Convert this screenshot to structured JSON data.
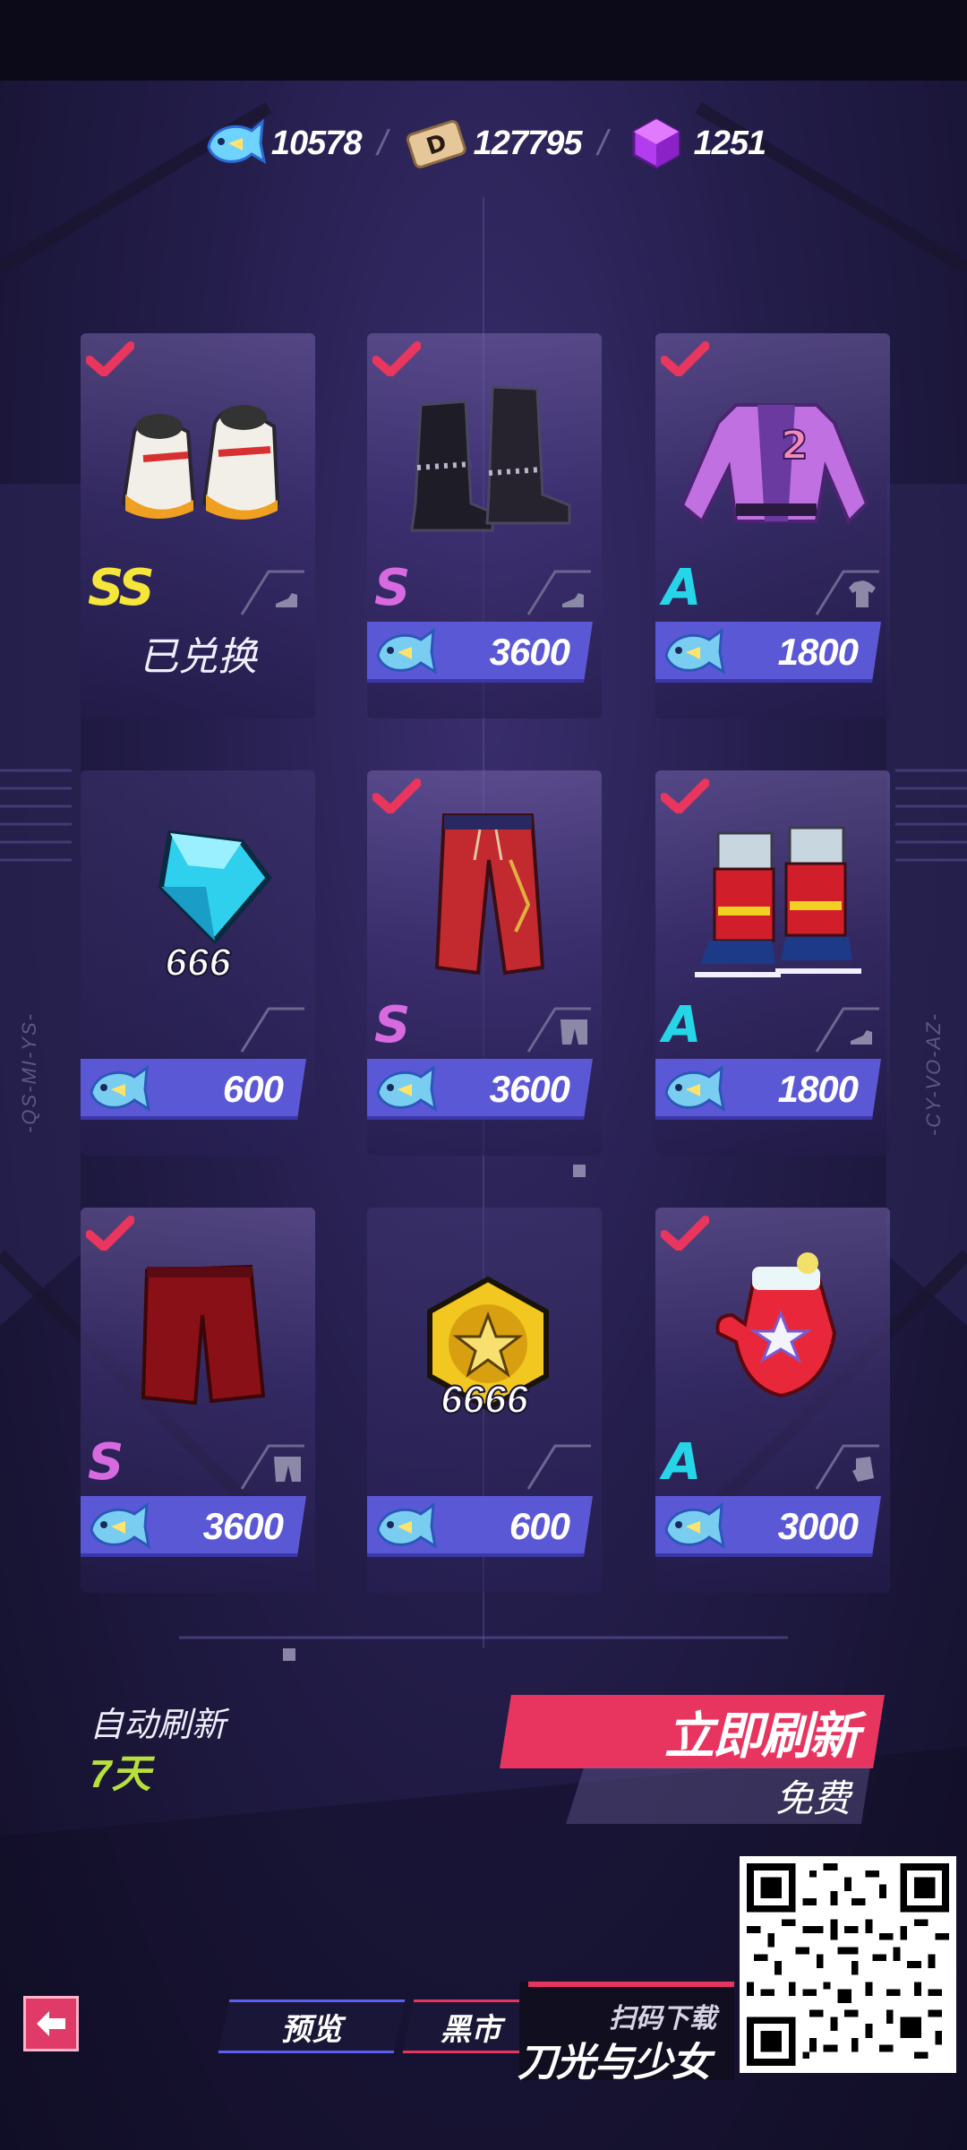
{
  "currencies": [
    {
      "icon": "fish-coin-icon",
      "value": "10578"
    },
    {
      "icon": "d-ticket-icon",
      "value": "127795"
    },
    {
      "icon": "purple-cube-icon",
      "value": "1251"
    }
  ],
  "currency_separator": "/",
  "shop_items": [
    {
      "name": "white-sneakers",
      "owned": true,
      "rank": "SS",
      "slot": "shoes",
      "status": "已兑换"
    },
    {
      "name": "black-boots",
      "owned": true,
      "rank": "S",
      "slot": "shoes",
      "price": "3600"
    },
    {
      "name": "purple-jacket",
      "owned": true,
      "rank": "A",
      "slot": "top",
      "price": "1800"
    },
    {
      "name": "blue-diamond",
      "owned": false,
      "rank": "",
      "quantity": "666",
      "price": "600"
    },
    {
      "name": "red-pants",
      "owned": true,
      "rank": "S",
      "slot": "bottom",
      "price": "3600"
    },
    {
      "name": "red-skates",
      "owned": true,
      "rank": "A",
      "slot": "shoes",
      "price": "1800"
    },
    {
      "name": "red-shorts",
      "owned": true,
      "rank": "S",
      "slot": "bottom",
      "price": "3600"
    },
    {
      "name": "gold-star-coin",
      "owned": false,
      "rank": "",
      "quantity": "6666",
      "price": "600"
    },
    {
      "name": "red-mitten",
      "owned": true,
      "rank": "A",
      "slot": "gloves",
      "price": "3000"
    }
  ],
  "side_labels": {
    "left": "-QS-MI-YS-",
    "right": "-CY-VO-AZ-"
  },
  "refresh": {
    "auto_label": "自动刷新",
    "auto_days": "7天",
    "button_label": "立即刷新",
    "cost_label": "免费"
  },
  "bottom_nav": {
    "tab_preview": "预览",
    "tab_black": "黑市"
  },
  "promo": {
    "scan_label": "扫码下载",
    "game_name": "刀光与少女"
  },
  "colors": {
    "rank_ss": "#f6e63a",
    "rank_s": "#d86ae0",
    "rank_a": "#26d6e8",
    "price_bar": "#5b58d6",
    "refresh_button": "#e83560",
    "auto_days": "#b8e03a"
  }
}
